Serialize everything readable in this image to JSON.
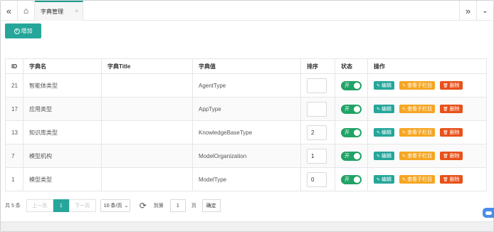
{
  "tabbar": {
    "tab_label": "字典管理",
    "close_glyph": "×",
    "left_nav_glyph": "«",
    "home_glyph": "⌂",
    "right_nav_glyph": "»",
    "dropdown_glyph": "⌄"
  },
  "toolbar": {
    "add_label": "增加",
    "add_icon": "+"
  },
  "table": {
    "headers": [
      "ID",
      "字典名",
      "字典Title",
      "字典值",
      "排序",
      "状态",
      "操作"
    ],
    "rows": [
      {
        "id": "21",
        "name": "智能体类型",
        "title": "",
        "value": "AgentType",
        "sort": "",
        "status": "开"
      },
      {
        "id": "17",
        "name": "应用类型",
        "title": "",
        "value": "AppType",
        "sort": "",
        "status": "开"
      },
      {
        "id": "13",
        "name": "知识库类型",
        "title": "",
        "value": "KnowledgeBaseType",
        "sort": "2",
        "status": "开"
      },
      {
        "id": "7",
        "name": "模型机构",
        "title": "",
        "value": "ModelOrganization",
        "sort": "1",
        "status": "开"
      },
      {
        "id": "1",
        "name": "模型类型",
        "title": "",
        "value": "ModelType",
        "sort": "0",
        "status": "开"
      }
    ],
    "actions": {
      "edit": "编辑",
      "view_children": "查看子栏目",
      "delete": "删除"
    }
  },
  "pager": {
    "total": "共 5 条",
    "prev": "上一页",
    "current": "1",
    "next": "下一页",
    "page_size": "10 条/页",
    "goto_label": "到第",
    "goto_value": "1",
    "page_unit": "页",
    "confirm": "确定"
  },
  "colors": {
    "accent": "#26a69a",
    "toggle_on": "#21a366",
    "view": "#f5a623",
    "delete": "#e8511a"
  }
}
